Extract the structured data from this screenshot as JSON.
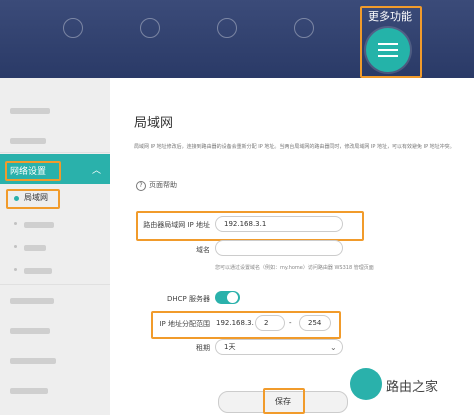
{
  "header": {
    "more_label": "更多功能",
    "nav_items": [
      "",
      "",
      "",
      "",
      ""
    ]
  },
  "sidebar": {
    "active_group": "网络设置",
    "active_item": "局域网"
  },
  "page": {
    "title": "局域网",
    "description": "局域网 IP 地址修改后，连接到路由器的设备会重新分配 IP 地址。当两台局域网的路由器同时，修改局域网 IP 地址，可以有效避免 IP 地址冲突。",
    "help": "页面帮助"
  },
  "form": {
    "router_ip_label": "路由器局域网 IP 地址",
    "router_ip_value": "192.168.3.1",
    "domain_label": "域名",
    "domain_hint": "您可以通过设置域名（例如：my.home）访问路由器 WS318 管理页面",
    "dhcp_label": "DHCP 服务器",
    "range_label": "IP 地址分配范围",
    "range_prefix": "192.168.3.",
    "range_start": "2",
    "range_end": "254",
    "lease_label": "租期",
    "lease_value": "1天",
    "save_label": "保存"
  },
  "watermark": {
    "text": "路由之家"
  },
  "colors": {
    "accent": "#2ab1ab",
    "highlight": "#f19b2b",
    "header": "#34456f"
  }
}
